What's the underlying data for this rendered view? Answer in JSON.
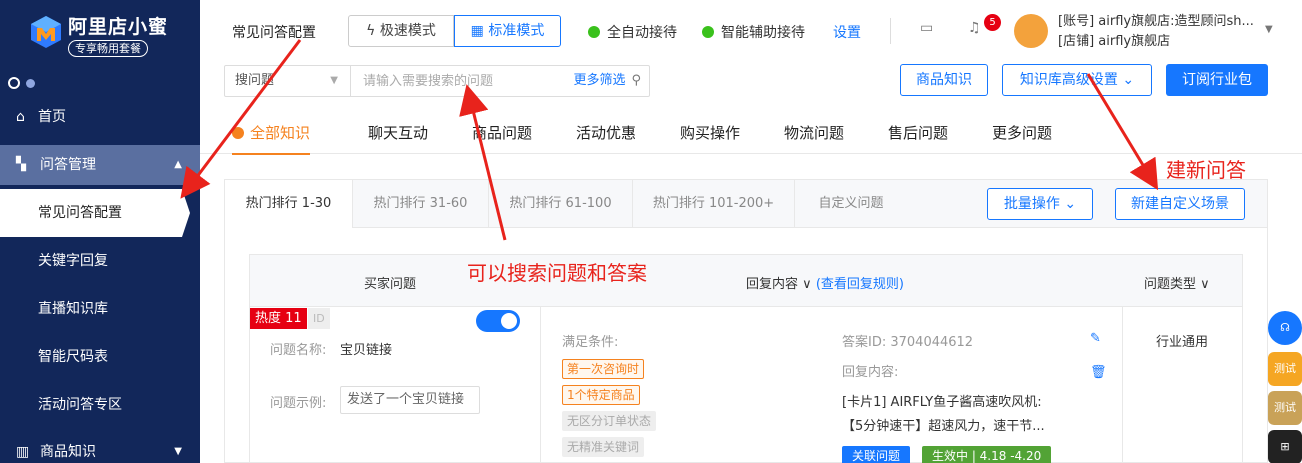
{
  "sidebar": {
    "brand": "阿里店小蜜",
    "badge": "专享畅用套餐",
    "home": "首页",
    "qa_manage": "问答管理",
    "sub_items": [
      "常见问答配置",
      "关键字回复",
      "直播知识库",
      "智能尺码表",
      "活动问答专区"
    ],
    "goods": "商品知识"
  },
  "header": {
    "page_title": "常见问答配置",
    "mode_fast": "极速模式",
    "mode_std": "标准模式",
    "status1": "全自动接待",
    "status2": "智能辅助接待",
    "settings": "设置",
    "bell_count": "5",
    "account": "[账号] airfly旗舰店:造型顾问sh...",
    "shop": "[店铺] airfly旗舰店"
  },
  "search": {
    "select": "搜问题",
    "placeholder": "请输入需要搜索的问题",
    "more": "更多筛选"
  },
  "actions": {
    "goods_knowledge": "商品知识",
    "advanced": "知识库高级设置",
    "subscribe": "订阅行业包"
  },
  "categories": [
    "全部知识",
    "聊天互动",
    "商品问题",
    "活动优惠",
    "购买操作",
    "物流问题",
    "售后问题",
    "更多问题"
  ],
  "rank_tabs": [
    "热门排行 1-30",
    "热门排行 31-60",
    "热门排行 61-100",
    "热门排行 101-200+",
    "自定义问题"
  ],
  "panel_actions": {
    "batch": "批量操作",
    "new_scene": "新建自定义场景"
  },
  "table": {
    "col_question": "买家问题",
    "col_reply": "回复内容",
    "col_reply_rule": "(查看回复规则)",
    "col_type": "问题类型"
  },
  "row": {
    "heat": "热度 11",
    "id_tag": "ID",
    "name_label": "问题名称:",
    "name_value": "宝贝链接",
    "example_label": "问题示例:",
    "example_value": "发送了一个宝贝链接",
    "condition_label": "满足条件:",
    "tags_orange": [
      "第一次咨询时",
      "1个特定商品"
    ],
    "tags_gray": [
      "无区分订单状态",
      "无精准关键词"
    ],
    "answer_id": "答案ID: 3704044612",
    "reply_label": "回复内容:",
    "card_line1": "[卡片1]  AIRFLY鱼子酱高速吹风机:",
    "card_line2": "【5分钟速干】超速风力，速干节...",
    "tag_related": "关联问题",
    "tag_effective": "生效中 | 4.18 -4.20",
    "type": "行业通用"
  },
  "annotations": {
    "search_hint": "可以搜索问题和答案",
    "new_hint": "建新问答"
  },
  "floating": {
    "test1": "测试",
    "test2": "测试"
  },
  "colors": {
    "primary": "#1677ff",
    "sidebar": "#12275a",
    "accent": "#f5821f",
    "red": "#e8231c"
  }
}
